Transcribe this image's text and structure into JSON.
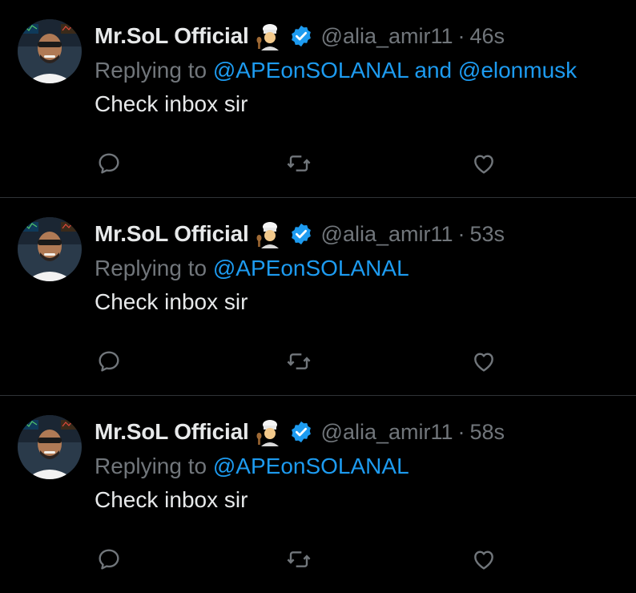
{
  "tweets": [
    {
      "author_name": "Mr.SoL Official",
      "handle": "@alia_amir11",
      "separator": "·",
      "time": "46s",
      "replying_prefix": "Replying to",
      "mention_1": "@APEonSOLANAL",
      "conjunction": "and",
      "mention_2": "@elonmusk",
      "text": "Check inbox sir"
    },
    {
      "author_name": "Mr.SoL Official",
      "handle": "@alia_amir11",
      "separator": "·",
      "time": "53s",
      "replying_prefix": "Replying to",
      "mention_1": "@APEonSOLANAL",
      "text": "Check inbox sir"
    },
    {
      "author_name": "Mr.SoL Official",
      "handle": "@alia_amir11",
      "separator": "·",
      "time": "58s",
      "replying_prefix": "Replying to",
      "mention_1": "@APEonSOLANAL",
      "text": "Check inbox sir"
    }
  ],
  "icons": {
    "emoji": "cook-emoji-icon",
    "verified": "verified-badge-icon",
    "reply": "reply-icon",
    "retweet": "retweet-icon",
    "like": "like-icon"
  },
  "colors": {
    "background": "#000000",
    "text": "#e7e9ea",
    "muted": "#71767b",
    "accent": "#1d9bf0",
    "divider": "#2f3336"
  }
}
